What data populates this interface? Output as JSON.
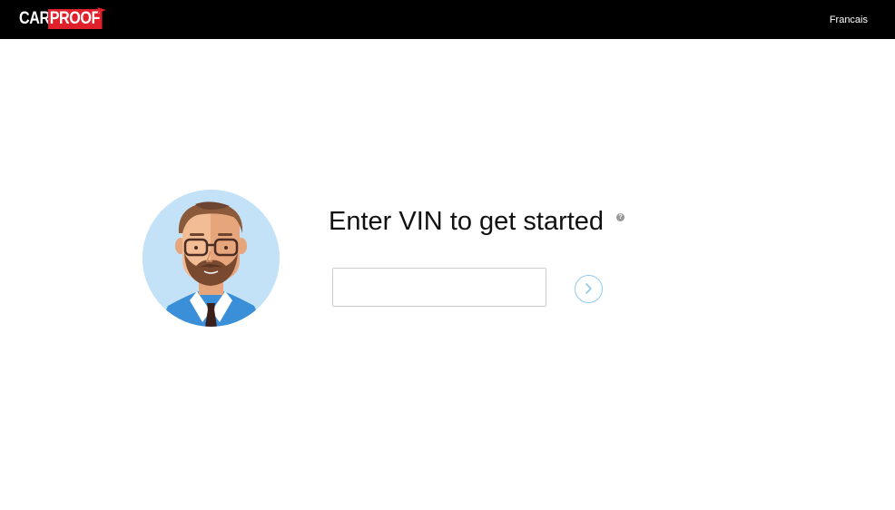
{
  "header": {
    "logo_text_primary": "CAR",
    "logo_text_secondary": "PROOF",
    "language_link": "Francais"
  },
  "main": {
    "heading": "Enter VIN to get started",
    "help_icon_glyph": "?",
    "vin_input": {
      "value": "",
      "placeholder": ""
    },
    "submit_icon": "chevron-right-icon"
  },
  "colors": {
    "topbar_bg": "#000000",
    "logo_red": "#e0202a",
    "avatar_bg": "#c4e2f7",
    "button_border": "#8fcbef"
  }
}
